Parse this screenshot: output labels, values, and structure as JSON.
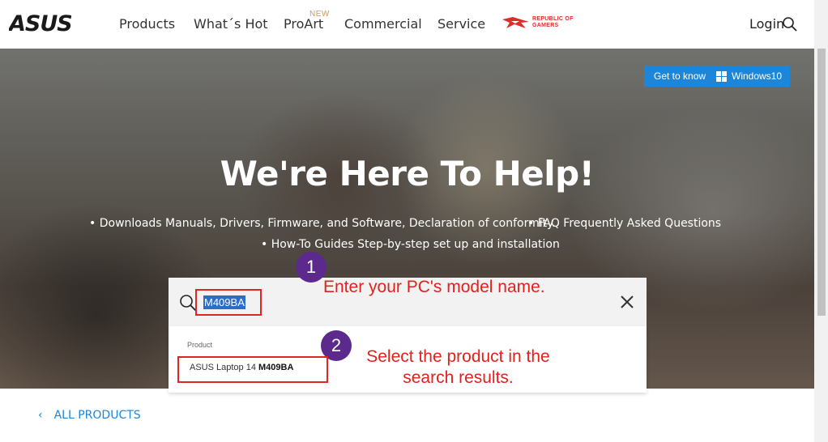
{
  "header": {
    "logo_text": "ASUS",
    "nav": [
      "Products",
      "What´s Hot",
      "ProArt",
      "Commercial",
      "Service"
    ],
    "proart_badge": "NEW",
    "rog_text_line1": "REPUBLIC OF",
    "rog_text_line2": "GAMERS",
    "login": "Login"
  },
  "hero": {
    "windows_button_prefix": "Get to know",
    "windows_button_name": "Windows10",
    "title": "We're Here To Help!",
    "bullet_1": "Downloads Manuals, Drivers, Firmware, and Software, Declaration of conformity.",
    "bullet_2": "FAQ Frequently Asked Questions",
    "bullet_3": "How-To Guides Step-by-step set up and installation"
  },
  "search": {
    "query": "M409BA",
    "results_header": "Product",
    "result_prefix": "ASUS Laptop 14",
    "result_bold": "M409BA"
  },
  "annotations": {
    "step1_number": "1",
    "step1_text": "Enter your PC's model name.",
    "step2_number": "2",
    "step2_line1": "Select the product in the",
    "step2_line2": "search results."
  },
  "footer": {
    "all_products": "ALL PRODUCTS"
  },
  "colors": {
    "accent_blue": "#1d86d8",
    "annotation_red": "#e0221b",
    "badge_purple": "#5b2a8c",
    "rog_red": "#e02c2c"
  }
}
